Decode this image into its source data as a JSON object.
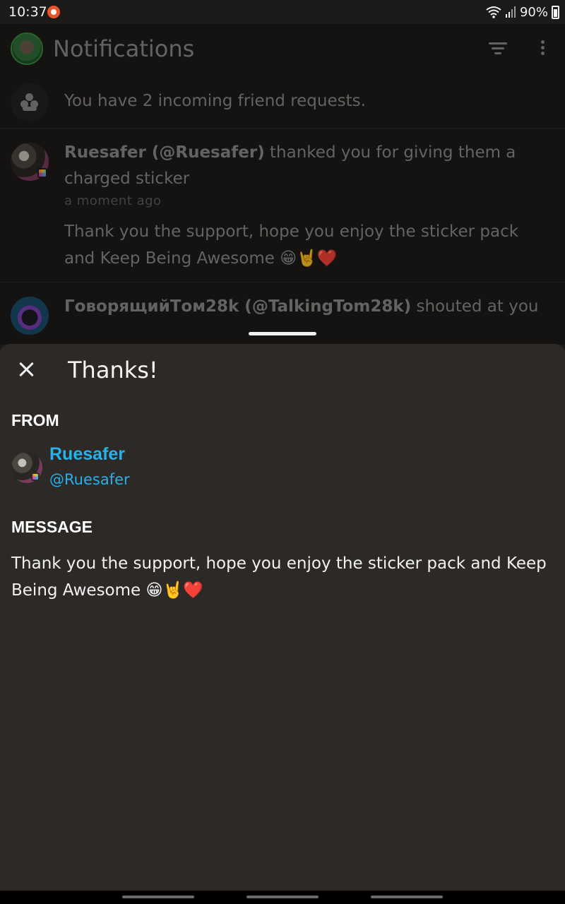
{
  "status_bar": {
    "time": "10:37",
    "battery": "90%"
  },
  "app_bar": {
    "title": "Notifications"
  },
  "friend_requests": {
    "text": "You have 2 incoming friend requests."
  },
  "notifications": [
    {
      "sender": "Ruesafer (@Ruesafer)",
      "action": " thanked you for giving them a charged sticker",
      "time": "a moment ago",
      "message": "Thank you the support, hope you enjoy the sticker pack and Keep Being Awesome 😁🤘❤️"
    },
    {
      "sender": "ГоворящийТом28k (@TalkingTom28k)",
      "action": " shouted at you"
    }
  ],
  "sheet": {
    "title": "Thanks!",
    "from_label": "FROM",
    "sender_name": "Ruesafer",
    "sender_handle": "@Ruesafer",
    "message_label": "MESSAGE",
    "message": "Thank you the support, hope you enjoy the sticker pack and Keep Being Awesome 😁🤘❤️"
  },
  "colors": {
    "accent": "#27b1ea",
    "sheet_bg": "#2c2927",
    "list_bg": "#1c1b1a"
  },
  "icons": [
    "notification-app-icon",
    "wifi-icon",
    "signal-icon",
    "battery-icon",
    "filter-icon",
    "more-vert-icon",
    "people-icon",
    "close-icon"
  ]
}
